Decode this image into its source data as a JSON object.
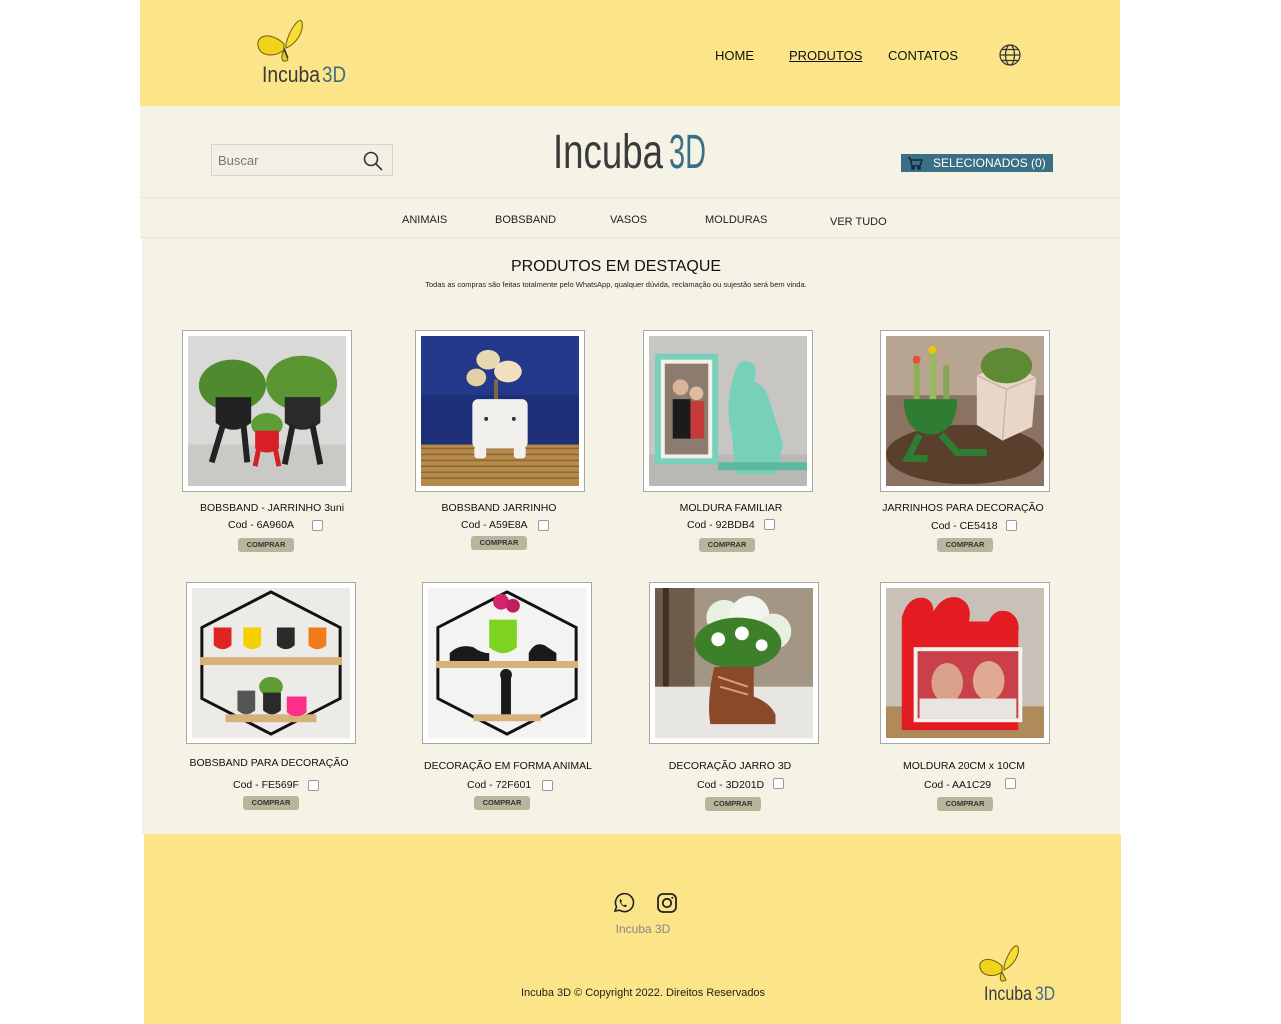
{
  "brand": {
    "name_main": "Incuba",
    "name_accent": "3D"
  },
  "nav": {
    "home": "HOME",
    "produtos": "PRODUTOS",
    "contatos": "CONTATOS"
  },
  "search": {
    "placeholder": "Buscar"
  },
  "cart": {
    "label": "SELECIONADOS (0)"
  },
  "categories": [
    "ANIMAIS",
    "BOBSBAND",
    "VASOS",
    "MOLDURAS",
    "VER TUDO"
  ],
  "section": {
    "title": "PRODUTOS EM DESTAQUE",
    "subtitle": "Todas as compras são feitas totalmente pelo WhatsApp, qualquer dúvida, reclamação ou sujestão será bem vinda."
  },
  "products": [
    {
      "name": "BOBSBAND - JARRINHO 3uni",
      "code": "Cod - 6A960A",
      "buy": "COMPRAR"
    },
    {
      "name": "BOBSBAND JARRINHO",
      "code": "Cod - A59E8A",
      "buy": "COMPRAR"
    },
    {
      "name": "MOLDURA FAMILIAR",
      "code": "Cod - 92BDB4",
      "buy": "COMPRAR"
    },
    {
      "name": "JARRINHOS PARA DECORAÇÃO",
      "code": "Cod - CE5418",
      "buy": "COMPRAR"
    },
    {
      "name": "BOBSBAND PARA DECORAÇÃO",
      "code": "Cod - FE569F",
      "buy": "COMPRAR"
    },
    {
      "name": "DECORAÇÃO EM FORMA ANIMAL",
      "code": "Cod - 72F601",
      "buy": "COMPRAR"
    },
    {
      "name": "DECORAÇÃO JARRO 3D",
      "code": "Cod - 3D201D",
      "buy": "COMPRAR"
    },
    {
      "name": "MOLDURA 20CM  x 10CM",
      "code": "Cod -  AA1C29",
      "buy": "COMPRAR"
    }
  ],
  "footer": {
    "name": "Incuba 3D",
    "copyright": "Incuba 3D © Copyright 2022. Direitos Reservados"
  },
  "colors": {
    "header_bg": "#fce488",
    "band_bg": "#f5f2e6",
    "accent": "#3b6f86",
    "buy_bg": "#b6b69c"
  }
}
